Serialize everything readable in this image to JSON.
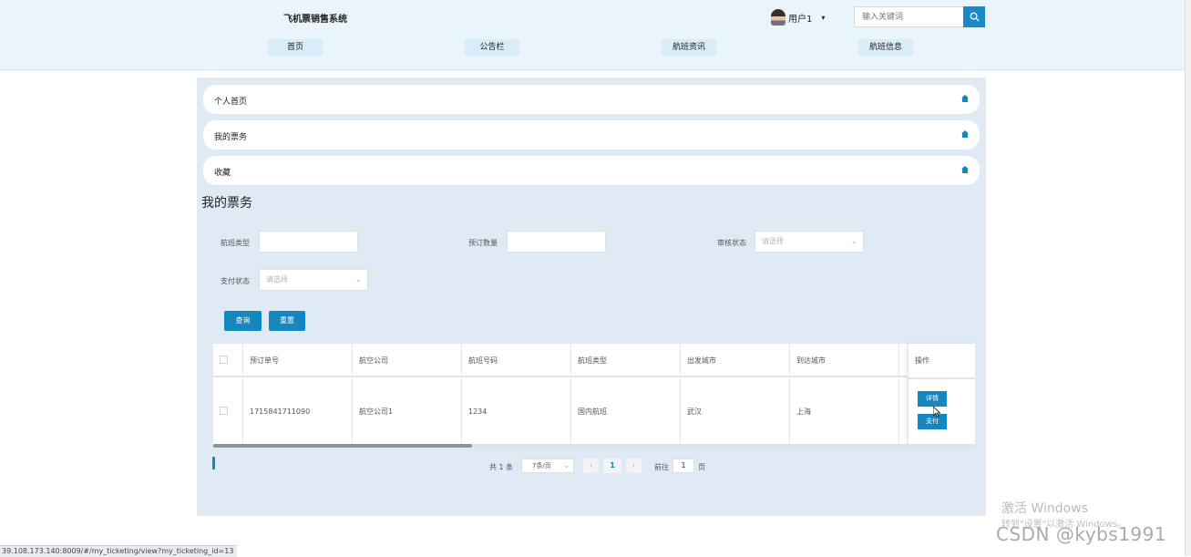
{
  "header": {
    "site_title": "飞机票销售系统",
    "user_name": "用户1",
    "search_placeholder": "输入关键词",
    "nav": [
      "首页",
      "公告栏",
      "航班资讯",
      "航班信息"
    ]
  },
  "sidebar_menu": [
    "个人首页",
    "我的票务",
    "收藏"
  ],
  "page_title": "我的票务",
  "filters": {
    "flight_type_label": "航班类型",
    "order_qty_label": "预订数量",
    "audit_status_label": "审核状态",
    "audit_status_placeholder": "请选择",
    "pay_status_label": "支付状态",
    "pay_status_placeholder": "请选择",
    "query_button": "查询",
    "reset_button": "重置"
  },
  "table": {
    "columns": [
      "预订单号",
      "航空公司",
      "航班号码",
      "航班类型",
      "出发城市",
      "到达城市"
    ],
    "action_column": "操作",
    "rows": [
      {
        "cells": [
          "1715841711090",
          "航空公司1",
          "1234",
          "国内航班",
          "武汉",
          "上海"
        ],
        "detail_button": "详情",
        "pay_button": "支付"
      }
    ]
  },
  "pagination": {
    "total_text": "共 1 条",
    "page_size": "7条/页",
    "current_page": "1",
    "goto_label": "前往",
    "goto_value": "1",
    "page_suffix": "页"
  },
  "status_url": "39.108.173.140:8009/#/my_ticketing/view?my_ticketing_id=13",
  "watermarks": {
    "windows_title": "激活 Windows",
    "windows_sub": "转到\"设置\"以激活 Windows。",
    "csdn": "CSDN @kybs1991"
  },
  "colors": {
    "accent": "#1387be",
    "header_bg": "#eaf4fb",
    "panel_bg": "#dfeaf5"
  }
}
